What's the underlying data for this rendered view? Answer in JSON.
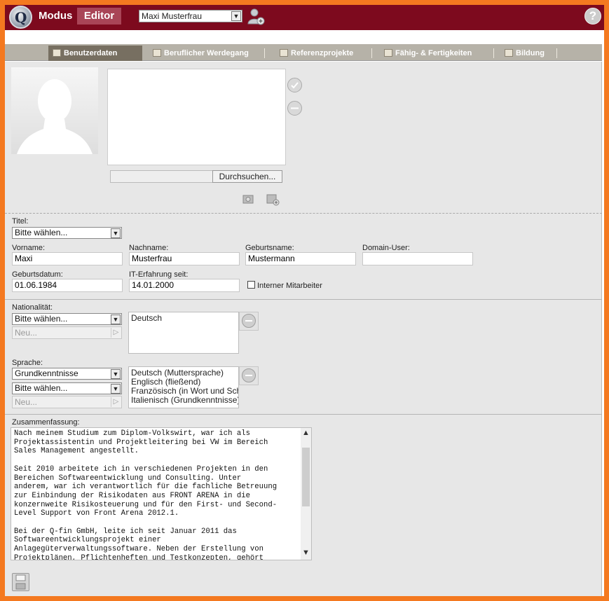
{
  "header": {
    "app_name": "Modus",
    "mode_label": "Editor",
    "user_select": "Maxi Musterfrau",
    "help_glyph": "?"
  },
  "tabs": [
    {
      "label": "Benutzerdaten",
      "icon": "card-icon",
      "active": true
    },
    {
      "label": "Beruflicher Werdegang",
      "icon": "career-icon",
      "active": false
    },
    {
      "label": "Referenzprojekte",
      "icon": "folder-icon",
      "active": false
    },
    {
      "label": "Fähig- & Fertigkeiten",
      "icon": "gear-icon",
      "active": false
    },
    {
      "label": "Bildung",
      "icon": "book-icon",
      "active": false
    }
  ],
  "photo": {
    "browse_label": "Durchsuchen..."
  },
  "form": {
    "titel_label": "Titel:",
    "titel_value": "Bitte wählen...",
    "vorname_label": "Vorname:",
    "vorname_value": "Maxi",
    "nachname_label": "Nachname:",
    "nachname_value": "Musterfrau",
    "geburtsname_label": "Geburtsname:",
    "geburtsname_value": "Mustermann",
    "domain_label": "Domain-User:",
    "domain_value": "",
    "geburtsdatum_label": "Geburtsdatum:",
    "geburtsdatum_value": "01.06.1984",
    "it_label": "IT-Erfahrung seit:",
    "it_value": "14.01.2000",
    "intern_label": "Interner Mitarbeiter"
  },
  "nationalitaet": {
    "label": "Nationalität:",
    "select_value": "Bitte wählen...",
    "new_placeholder": "Neu...",
    "items": [
      "Deutsch"
    ]
  },
  "sprache": {
    "label": "Sprache:",
    "level_value": "Grundkenntnisse",
    "select_value": "Bitte wählen...",
    "new_placeholder": "Neu...",
    "items": [
      "Deutsch (Muttersprache)",
      "Englisch (fließend)",
      "Französisch (in Wort und Schr",
      "Italienisch (Grundkenntnisse)"
    ]
  },
  "summary": {
    "label": "Zusammenfassung:",
    "text": "Nach meinem Studium zum Diplom-Volkswirt, war ich als\nProjektassistentin und Projektleitering bei VW im Bereich\nSales Management angestellt.\n\nSeit 2010 arbeitete ich in verschiedenen Projekten in den\nBereichen Softwareentwicklung und Consulting. Unter\nanderem, war ich verantwortlich für die fachliche Betreuung\nzur Einbindung der Risikodaten aus FRONT ARENA in die\nkonzernweite Risikosteuerung und für den First- und Second-\nLevel Support von Front Arena 2012.1.\n\nBei der Q-fin GmbH, leite ich seit Januar 2011 das\nSoftwareentwicklungsprojekt einer\nAnlagegüterverwaltungssoftware. Neben der Erstellung von\nProjektplänen, Pflichtenheften und Testkonzepten, gehört"
  },
  "colors": {
    "outer_border": "#f47920",
    "header_bg": "#7d0a1e",
    "badge_bg": "#a94557",
    "tabbar_bg": "#b6b2a8",
    "active_tab_bg": "#776f61",
    "content_bg": "#e7e7e7"
  }
}
